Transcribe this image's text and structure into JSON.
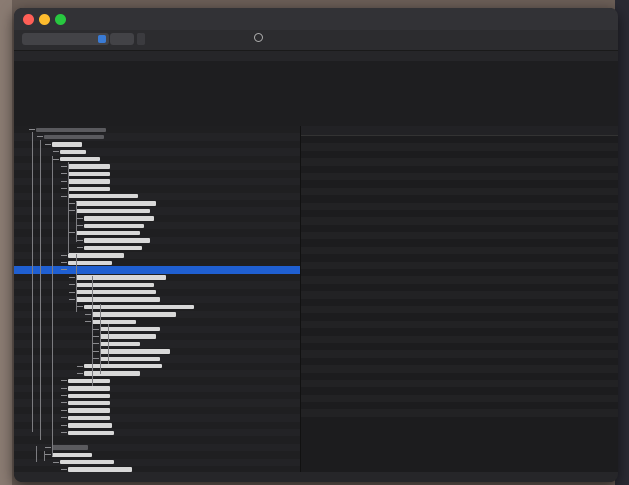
{
  "window": {
    "title": ""
  },
  "toolbar": {
    "plane_popup": "",
    "search_text": ""
  },
  "path": "",
  "info": {
    "name": "",
    "class_inheritance_label": "",
    "class_inheritance_value": "",
    "bundle_label": "",
    "bundle_value": ""
  },
  "tree": {
    "rows": [
      {
        "d": 1,
        "w": 70,
        "dim": true
      },
      {
        "d": 2,
        "w": 60,
        "dim": true
      },
      {
        "d": 3,
        "w": 30
      },
      {
        "d": 4,
        "w": 26
      },
      {
        "d": 4,
        "w": 40
      },
      {
        "d": 5,
        "w": 42
      },
      {
        "d": 5,
        "w": 42
      },
      {
        "d": 5,
        "w": 42
      },
      {
        "d": 5,
        "w": 42
      },
      {
        "d": 5,
        "w": 70
      },
      {
        "d": 6,
        "w": 80
      },
      {
        "d": 6,
        "w": 74
      },
      {
        "d": 7,
        "w": 70
      },
      {
        "d": 7,
        "w": 60
      },
      {
        "d": 6,
        "w": 64
      },
      {
        "d": 7,
        "w": 66
      },
      {
        "d": 7,
        "w": 58
      },
      {
        "d": 5,
        "w": 56
      },
      {
        "d": 5,
        "w": 44
      },
      {
        "d": 5,
        "w": 60,
        "sel": true,
        "label": ""
      },
      {
        "d": 6,
        "w": 90
      },
      {
        "d": 6,
        "w": 78
      },
      {
        "d": 6,
        "w": 80
      },
      {
        "d": 6,
        "w": 84
      },
      {
        "d": 7,
        "w": 110
      },
      {
        "d": 8,
        "w": 84
      },
      {
        "d": 8,
        "w": 44
      },
      {
        "d": 9,
        "w": 60
      },
      {
        "d": 9,
        "w": 56
      },
      {
        "d": 9,
        "w": 40
      },
      {
        "d": 9,
        "w": 70
      },
      {
        "d": 9,
        "w": 60
      },
      {
        "d": 7,
        "w": 78
      },
      {
        "d": 7,
        "w": 56
      },
      {
        "d": 5,
        "w": 42
      },
      {
        "d": 5,
        "w": 42
      },
      {
        "d": 5,
        "w": 42
      },
      {
        "d": 5,
        "w": 42
      },
      {
        "d": 5,
        "w": 42
      },
      {
        "d": 5,
        "w": 42
      },
      {
        "d": 5,
        "w": 44
      },
      {
        "d": 5,
        "w": 46
      },
      {
        "d": 0,
        "w": 0
      },
      {
        "d": 3,
        "w": 36,
        "dim": true
      },
      {
        "d": 3,
        "w": 40
      },
      {
        "d": 4,
        "w": 54
      },
      {
        "d": 5,
        "w": 64
      }
    ]
  },
  "properties": {
    "header": {
      "property": "",
      "type": "",
      "value": ""
    },
    "rows": [
      {
        "p": "",
        "t": "",
        "v": ""
      },
      {
        "p": "",
        "t": "",
        "v": ""
      },
      {
        "p": "",
        "t": "",
        "v": ""
      },
      {
        "p": "",
        "t": "",
        "v": ""
      },
      {
        "p": "",
        "t": "",
        "v": ""
      },
      {
        "p": "",
        "t": "",
        "v": ""
      },
      {
        "p": "",
        "t": "",
        "v": ""
      },
      {
        "p": "",
        "t": "",
        "v": ""
      },
      {
        "p": "",
        "t": "",
        "v": ""
      },
      {
        "p": "",
        "t": "",
        "v": ""
      },
      {
        "p": "",
        "t": "",
        "v": ""
      },
      {
        "p": "",
        "t": "",
        "v": ""
      },
      {
        "p": "",
        "t": "",
        "v": ""
      },
      {
        "p": "",
        "t": "",
        "v": ""
      },
      {
        "p": "",
        "t": "",
        "v": ""
      },
      {
        "p": "",
        "t": "",
        "v": ""
      },
      {
        "p": "",
        "t": "",
        "v": ""
      },
      {
        "p": "",
        "t": "",
        "v": ""
      },
      {
        "p": "",
        "t": "",
        "v": ""
      },
      {
        "p": "",
        "t": "",
        "v": ""
      },
      {
        "p": "",
        "t": "",
        "v": ""
      },
      {
        "p": "",
        "t": "",
        "v": ""
      },
      {
        "p": "",
        "t": "",
        "v": ""
      },
      {
        "p": "",
        "t": "",
        "v": ""
      },
      {
        "p": "",
        "t": "",
        "v": ""
      },
      {
        "p": "",
        "t": "",
        "v": ""
      },
      {
        "p": "",
        "t": "",
        "v": ""
      },
      {
        "p": "",
        "t": "",
        "v": ""
      },
      {
        "p": "",
        "t": "",
        "v": ""
      },
      {
        "p": "",
        "t": "",
        "v": ""
      },
      {
        "p": "",
        "t": "",
        "v": ""
      },
      {
        "p": "",
        "t": "",
        "v": ""
      },
      {
        "p": "",
        "t": "",
        "v": ""
      },
      {
        "p": "",
        "t": "",
        "v": ""
      },
      {
        "p": "",
        "t": "",
        "v": ""
      },
      {
        "p": "",
        "t": "",
        "v": ""
      },
      {
        "p": "",
        "t": "",
        "v": ""
      },
      {
        "p": "",
        "t": "",
        "v": ""
      },
      {
        "p": "",
        "t": "",
        "v": ""
      }
    ]
  },
  "status": "",
  "colors": {
    "selection": "#1f5fd1",
    "close": "#ff5f57",
    "minimize": "#febc2e",
    "zoom": "#28c840"
  }
}
